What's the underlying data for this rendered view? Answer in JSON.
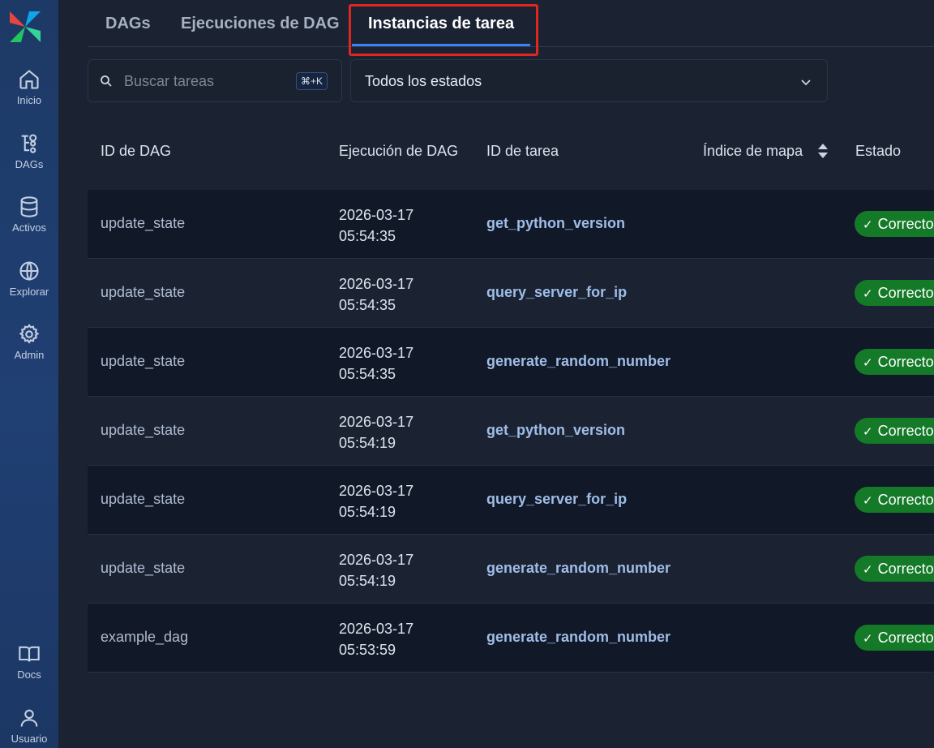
{
  "sidebar": {
    "items": [
      {
        "label": "Inicio",
        "icon": "home-icon"
      },
      {
        "label": "DAGs",
        "icon": "dags-icon"
      },
      {
        "label": "Activos",
        "icon": "database-icon"
      },
      {
        "label": "Explorar",
        "icon": "globe-icon"
      },
      {
        "label": "Admin",
        "icon": "gear-icon"
      },
      {
        "label": "Docs",
        "icon": "book-icon"
      },
      {
        "label": "Usuario",
        "icon": "user-icon"
      }
    ]
  },
  "tabs": [
    {
      "label": "DAGs"
    },
    {
      "label": "Ejecuciones de DAG"
    },
    {
      "label": "Instancias de tarea",
      "active": true
    }
  ],
  "search": {
    "placeholder": "Buscar tareas",
    "shortcut": "⌘+K",
    "value": ""
  },
  "status_filter": {
    "value": "Todos los estados"
  },
  "table": {
    "headers": {
      "dag_id": "ID de DAG",
      "dag_run": "Ejecución de DAG",
      "task_id": "ID de tarea",
      "map_index": "Índice de mapa",
      "state": "Estado"
    },
    "rows": [
      {
        "dag_id": "update_state",
        "date": "2026-03-17",
        "time": "05:54:35",
        "task_id": "get_python_version",
        "state": "Correcto"
      },
      {
        "dag_id": "update_state",
        "date": "2026-03-17",
        "time": "05:54:35",
        "task_id": "query_server_for_ip",
        "state": "Correcto"
      },
      {
        "dag_id": "update_state",
        "date": "2026-03-17",
        "time": "05:54:35",
        "task_id": "generate_random_number",
        "state": "Correcto"
      },
      {
        "dag_id": "update_state",
        "date": "2026-03-17",
        "time": "05:54:19",
        "task_id": "get_python_version",
        "state": "Correcto"
      },
      {
        "dag_id": "update_state",
        "date": "2026-03-17",
        "time": "05:54:19",
        "task_id": "query_server_for_ip",
        "state": "Correcto"
      },
      {
        "dag_id": "update_state",
        "date": "2026-03-17",
        "time": "05:54:19",
        "task_id": "generate_random_number",
        "state": "Correcto"
      },
      {
        "dag_id": "example_dag",
        "date": "2026-03-17",
        "time": "05:53:59",
        "task_id": "generate_random_number",
        "state": "Correcto"
      }
    ]
  },
  "colors": {
    "accent": "#3b82f6",
    "highlight_box": "#e0271f",
    "success_badge": "#147a28",
    "task_link": "#9fbde8"
  }
}
